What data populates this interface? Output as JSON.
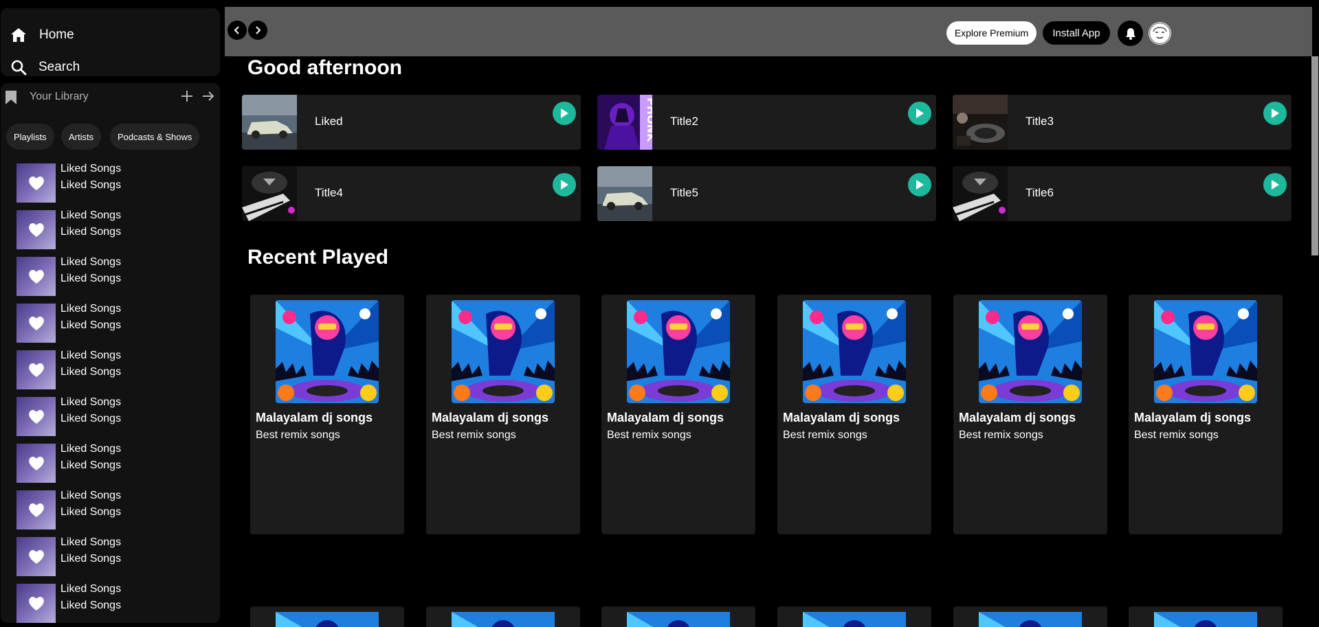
{
  "sidebar": {
    "nav": [
      {
        "label": "Home",
        "icon": "home-icon"
      },
      {
        "label": "Search",
        "icon": "search-icon"
      }
    ],
    "library": {
      "title": "Your Library",
      "chips": [
        "Playlists",
        "Artists",
        "Podcasts & Shows"
      ],
      "items": [
        {
          "line1": "Liked Songs",
          "line2": "Liked Songs"
        },
        {
          "line1": "Liked Songs",
          "line2": "Liked Songs"
        },
        {
          "line1": "Liked Songs",
          "line2": "Liked Songs"
        },
        {
          "line1": "Liked Songs",
          "line2": "Liked Songs"
        },
        {
          "line1": "Liked Songs",
          "line2": "Liked Songs"
        },
        {
          "line1": "Liked Songs",
          "line2": "Liked Songs"
        },
        {
          "line1": "Liked Songs",
          "line2": "Liked Songs"
        },
        {
          "line1": "Liked Songs",
          "line2": "Liked Songs"
        },
        {
          "line1": "Liked Songs",
          "line2": "Liked Songs"
        },
        {
          "line1": "Liked Songs",
          "line2": "Liked Songs"
        }
      ]
    }
  },
  "header": {
    "premium_label": "Explore Premium",
    "install_label": "Install App"
  },
  "main": {
    "greeting": "Good afternoon",
    "quick_picks": [
      {
        "title": "Liked",
        "art": "car-art"
      },
      {
        "title": "Title2",
        "art": "phonk-art"
      },
      {
        "title": "Title3",
        "art": "turntable-art"
      },
      {
        "title": "Title4",
        "art": "speaker-art"
      },
      {
        "title": "Title5",
        "art": "car-art"
      },
      {
        "title": "Title6",
        "art": "speaker-art"
      }
    ],
    "recent_heading": "Recent Played",
    "recent": [
      {
        "title": "Malayalam dj songs",
        "subtitle": "Best remix songs"
      },
      {
        "title": "Malayalam dj songs",
        "subtitle": "Best remix songs"
      },
      {
        "title": "Malayalam dj songs",
        "subtitle": "Best remix songs"
      },
      {
        "title": "Malayalam dj songs",
        "subtitle": "Best remix songs"
      },
      {
        "title": "Malayalam dj songs",
        "subtitle": "Best remix songs"
      },
      {
        "title": "Malayalam dj songs",
        "subtitle": "Best remix songs"
      }
    ]
  },
  "colors": {
    "accent": "#1db99c",
    "surface": "#1c1c1c",
    "sidebar": "#121212",
    "topbar": "#5a5a5a"
  }
}
